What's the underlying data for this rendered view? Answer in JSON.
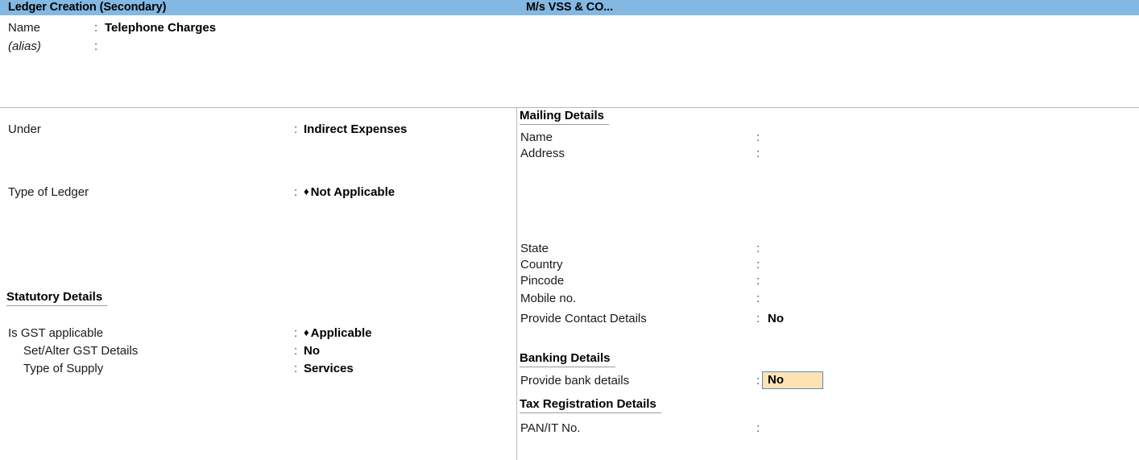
{
  "titlebar": {
    "left_title": "Ledger Creation (Secondary)",
    "center_title": "M/s VSS & CO...",
    "bg_color": "#83b8e3"
  },
  "header_fields": {
    "name_label": "Name",
    "name_colon": ":",
    "name_value": "Telephone Charges",
    "alias_label": "(alias)",
    "alias_colon": ":",
    "alias_value": ""
  },
  "left_panel": {
    "under": {
      "label": "Under",
      "colon": ":",
      "value": "Indirect Expenses"
    },
    "type_of_ledger": {
      "label": "Type of Ledger",
      "colon": ":",
      "marker": "♦",
      "value": "Not Applicable"
    },
    "statutory_details": {
      "heading": "Statutory Details",
      "rows": [
        {
          "label": "Is GST applicable",
          "colon": ":",
          "marker": "♦",
          "value": "Applicable",
          "indent": 0
        },
        {
          "label": "Set/Alter GST Details",
          "colon": ":",
          "marker": "",
          "value": "No",
          "indent": 1
        },
        {
          "label": "Type of Supply",
          "colon": ":",
          "marker": "",
          "value": "Services",
          "indent": 1
        }
      ]
    }
  },
  "right_panel": {
    "mailing_details": {
      "heading": "Mailing Details",
      "rows": [
        {
          "label": "Name",
          "colon": ":",
          "value": ""
        },
        {
          "label": "Address",
          "colon": ":",
          "value": ""
        }
      ],
      "rows2": [
        {
          "label": "State",
          "colon": ":",
          "value": ""
        },
        {
          "label": "Country",
          "colon": ":",
          "value": ""
        },
        {
          "label": "Pincode",
          "colon": ":",
          "value": ""
        },
        {
          "label": "Mobile no.",
          "colon": ":",
          "value": ""
        },
        {
          "label": "Provide Contact Details",
          "colon": ":",
          "value": "No"
        }
      ]
    },
    "banking_details": {
      "heading": "Banking Details",
      "provide_bank_details": {
        "label": "Provide bank details",
        "colon": ":",
        "value": "No",
        "focused": true,
        "bg_color": "#fde3b4",
        "border_color": "#5b8db8"
      }
    },
    "tax_registration_details": {
      "heading": "Tax Registration Details",
      "rows": [
        {
          "label": "PAN/IT No.",
          "colon": ":",
          "value": ""
        }
      ]
    }
  }
}
